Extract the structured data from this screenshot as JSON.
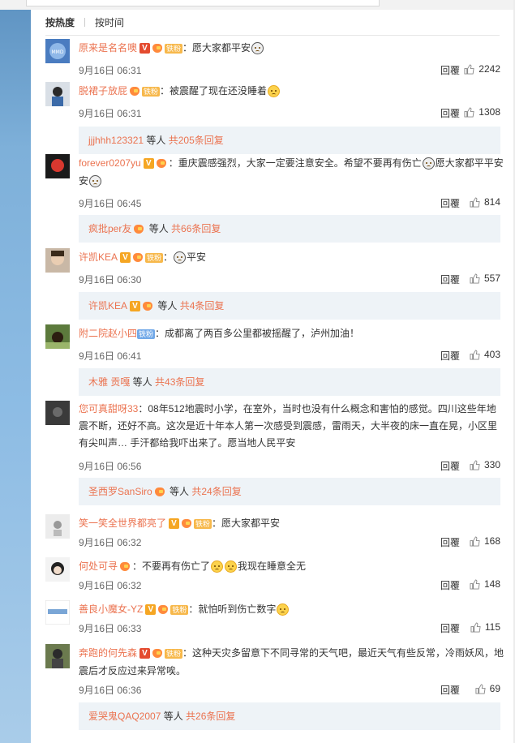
{
  "sort": {
    "hot": "按热度",
    "time": "按时间"
  },
  "reply_label": "回覆",
  "fan_label": "铁粉",
  "comments": [
    {
      "user": "原来是名名噢",
      "text": "：愿大家都平安",
      "date": "9月16日 06:31",
      "likes": "2242",
      "vip": "red",
      "fan": true
    },
    {
      "user": "脱裙子放屁",
      "text": "：被震醒了现在还没睡着",
      "date": "9月16日 06:31",
      "likes": "1308",
      "vip": "",
      "fan": true,
      "sub": {
        "name": "jjjhhh123321",
        "etc": " 等人 ",
        "count": "共205条回复"
      }
    },
    {
      "user": "forever0207yu",
      "text": "：重庆震感强烈，大家一定要注意安全。希望不要再有伤亡",
      "text2": "愿大家都平平安安",
      "date": "9月16日 06:45",
      "likes": "814",
      "vip": "orange",
      "fan": false,
      "sub": {
        "name": "疯批per友",
        "etc": " 等人 ",
        "count": "共66条回复"
      }
    },
    {
      "user": "许凯KEA",
      "text": "：",
      "text2": "平安",
      "date": "9月16日 06:30",
      "likes": "557",
      "vip": "orange",
      "fan": true,
      "sub": {
        "name": "许凯KEA",
        "etc": " 等人 ",
        "count": "共4条回复"
      }
    },
    {
      "user": "附二院赵小四",
      "text": "：成都离了两百多公里都被摇醒了，泸州加油！",
      "date": "9月16日 06:41",
      "likes": "403",
      "vip": "",
      "fan": true,
      "fanblue": true,
      "sub": {
        "name": "木雅 贡嘎",
        "etc": " 等人 ",
        "count": "共43条回复"
      }
    },
    {
      "user": "您可真甜呀33",
      "text": "：08年512地震时小学，在室外，当时也没有什么概念和害怕的感觉。四川这些年地震不断，还好不高。这次是近十年本人第一次感受到震感，雷雨天，大半夜的床一直在晃，小区里有尖叫声… 手汗都给我吓出来了。愿当地人民平安",
      "date": "9月16日 06:56",
      "likes": "330",
      "vip": "",
      "fan": false,
      "sub": {
        "name": "圣西罗SanSiro",
        "etc": " 等人 ",
        "count": "共24条回复"
      }
    },
    {
      "user": "笑一笑全世界都亮了",
      "text": "：愿大家都平安",
      "date": "9月16日 06:32",
      "likes": "168",
      "vip": "orange",
      "fan": true
    },
    {
      "user": "何处可寻",
      "text": "：不要再有伤亡了",
      "text2": "我现在睡意全无",
      "date": "9月16日 06:32",
      "likes": "148",
      "vip": "",
      "fan": false
    },
    {
      "user": "善良小魔女-YZ",
      "text": "：就怕听到伤亡数字",
      "date": "9月16日 06:33",
      "likes": "115",
      "vip": "orange",
      "fan": true
    },
    {
      "user": "奔跑的何先森",
      "text": "：这种天灾多留意下不同寻常的天气吧，最近天气有些反常，冷雨妖风，地震后才反应过来异常唉。",
      "date": "9月16日 06:36",
      "likes": "69",
      "vip": "red",
      "fan": true,
      "sub": {
        "name": "爱哭鬼QAQ2007",
        "etc": " 等人 ",
        "count": "共26条回复"
      }
    }
  ]
}
